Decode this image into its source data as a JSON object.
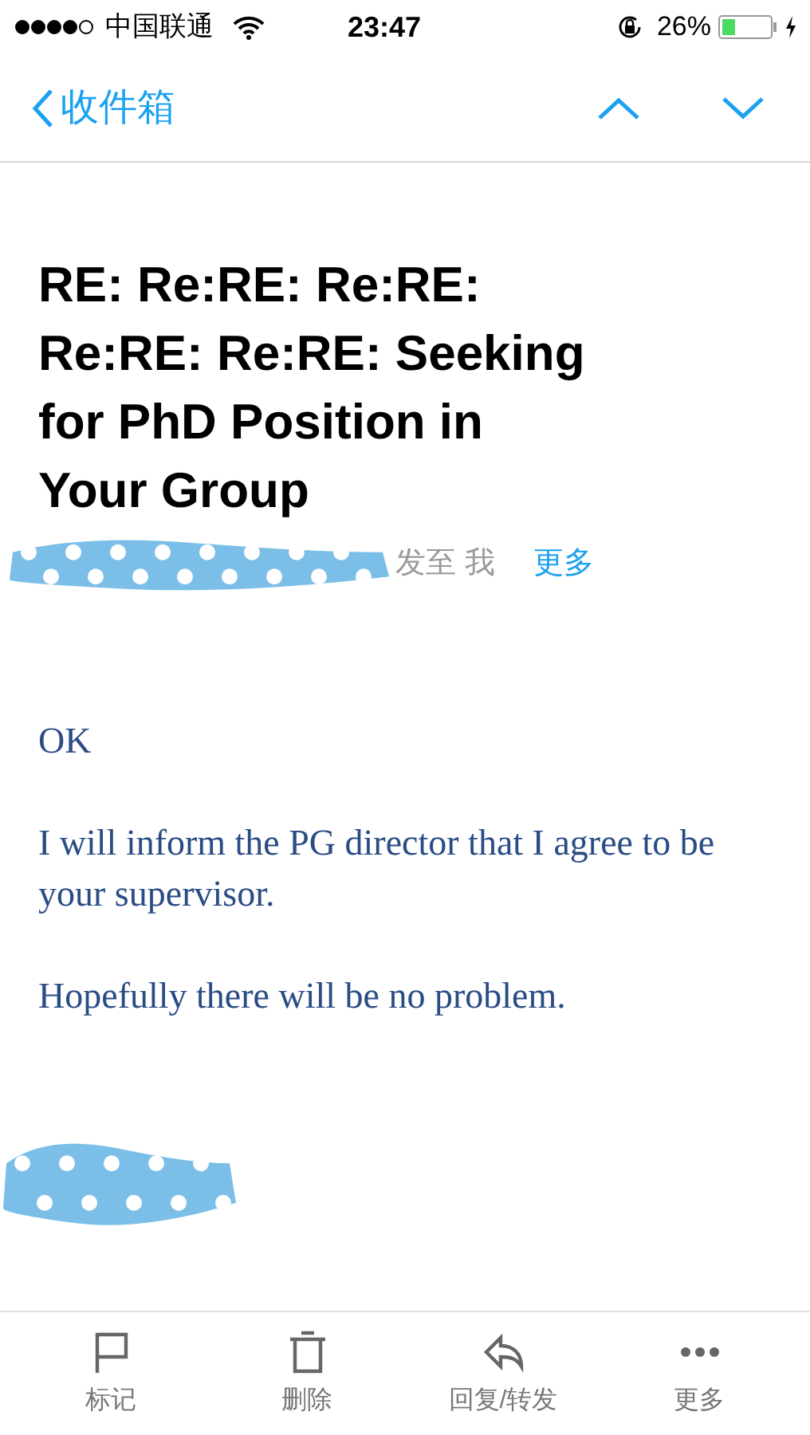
{
  "status_bar": {
    "carrier": "中国联通",
    "time": "23:47",
    "battery_percent": "26%"
  },
  "nav": {
    "back_label": "收件箱"
  },
  "message": {
    "subject": "RE: Re:RE: Re:RE: Re:RE: Re:RE: Seeking for PhD Position in Your Group",
    "recipient_text": "发至 我",
    "more_link": "更多",
    "body": [
      "OK",
      "I will inform the PG director that I agree to be your supervisor.",
      "Hopefully there will be no problem."
    ]
  },
  "toolbar": [
    {
      "kind": "flag",
      "label": "标记"
    },
    {
      "kind": "trash",
      "label": "删除"
    },
    {
      "kind": "reply",
      "label": "回复/转发"
    },
    {
      "kind": "more",
      "label": "更多"
    }
  ]
}
